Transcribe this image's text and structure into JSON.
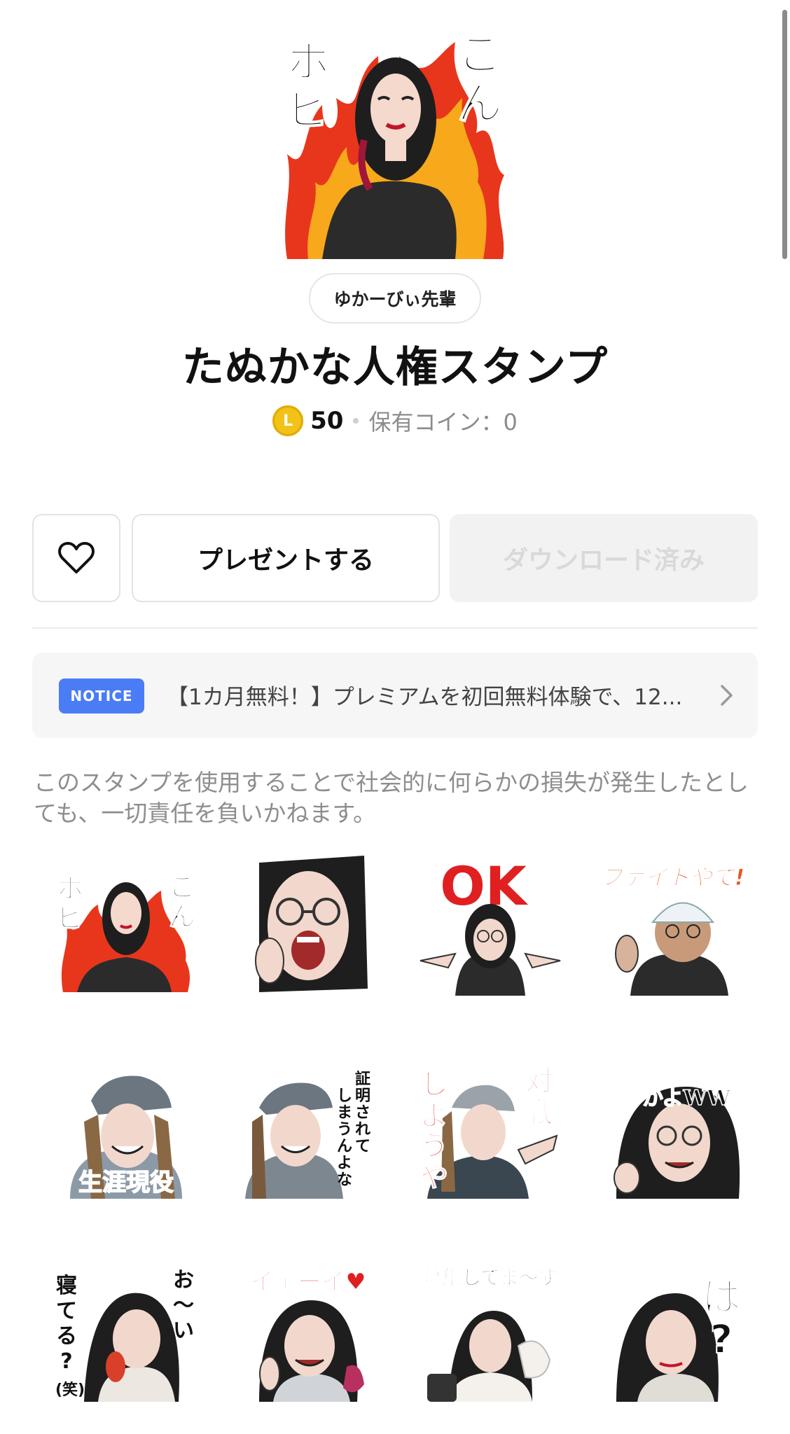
{
  "product": {
    "author": "ゆかーびぃ先輩",
    "title": "たぬかな人権スタンプ",
    "coin_symbol": "L",
    "price": "50",
    "owned_coins": "保有コイン：0"
  },
  "hero": {
    "text_right": "こん",
    "text_left": "ホビ"
  },
  "actions": {
    "like_icon": "heart-icon",
    "gift_label": "プレゼントする",
    "download_label": "ダウンロード済み"
  },
  "notice": {
    "badge": "NOTICE",
    "text": "【1カ月無料！】プレミアムを初回無料体験で、12...",
    "chevron_icon": "chevron-right-icon"
  },
  "description": "このスタンプを使用することで社会的に何らかの損失が発生したとしても、一切責任を負いかねます。",
  "stickers": [
    {
      "caption": "ホビ こん"
    },
    {
      "caption": ""
    },
    {
      "caption": "OK"
    },
    {
      "caption": "ファイトやで!"
    },
    {
      "caption": "生涯現役"
    },
    {
      "caption": "証明されてしまうんよな"
    },
    {
      "caption": "対戦しようや"
    },
    {
      "caption": "初心者かよWW"
    },
    {
      "caption": "お〜い 寝てる?(笑)"
    },
    {
      "caption": "イェーイ♥"
    },
    {
      "caption": "募集してま〜す"
    },
    {
      "caption": "は?"
    }
  ],
  "colors": {
    "coin": "#f2c218",
    "notice_badge": "#4a7cf6",
    "flame": "#e8361c",
    "caption_red": "#e02020"
  }
}
